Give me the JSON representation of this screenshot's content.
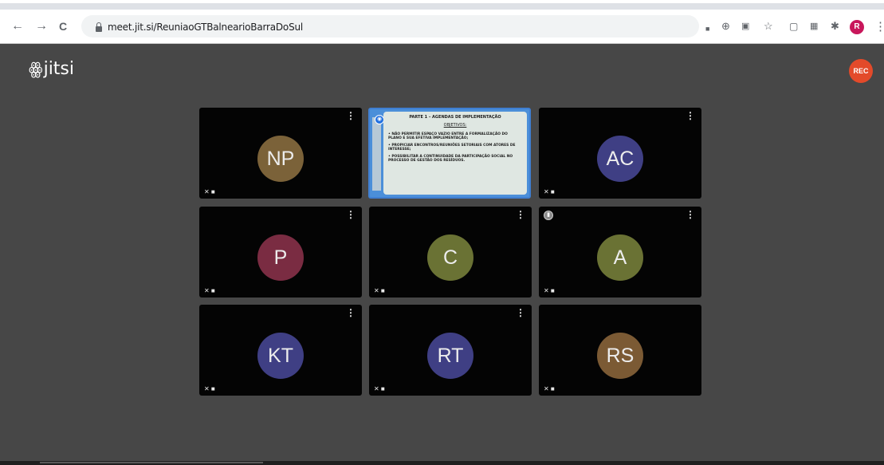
{
  "browser": {
    "url": "meet.jit.si/ReuniaoGTBalnearioBarraDoSul",
    "back_icon": "←",
    "forward_icon": "→",
    "reload_icon": "C",
    "profile_initial": "R"
  },
  "app": {
    "logo_text": "jitsi",
    "rec_label": "REC"
  },
  "tiles": [
    {
      "initials": "NP",
      "color": "#7b6239"
    },
    {
      "type": "screenshare"
    },
    {
      "initials": "AC",
      "color": "#3f3f84"
    },
    {
      "initials": "P",
      "color": "#7a2c42"
    },
    {
      "initials": "C",
      "color": "#6a7234"
    },
    {
      "initials": "A",
      "color": "#6a7234"
    },
    {
      "initials": "KT",
      "color": "#3f3f84"
    },
    {
      "initials": "RT",
      "color": "#3f3f84"
    },
    {
      "initials": "RS",
      "color": "#7b5a34"
    }
  ],
  "slide": {
    "title": "PARTE 1 – AGENDAS DE IMPLEMENTAÇÃO",
    "subtitle": "OBJETIVOS:",
    "bullets": [
      "• NÃO PERMITIR ESPAÇO VAZIO ENTRE A FORMALIZAÇÃO DO PLANO E SUA EFETIVA IMPLEMENTAÇÃO;",
      "• PROPICIAR ENCONTROS/REUNIÕES SETORIAIS COM ATORES DE INTERESSE;",
      "• POSSIBILITAR A CONTINUIDADE DA PARTICIPAÇÃO SOCIAL NO PROCESSO DE GESTÃO DOS RESÍDUOS."
    ]
  }
}
